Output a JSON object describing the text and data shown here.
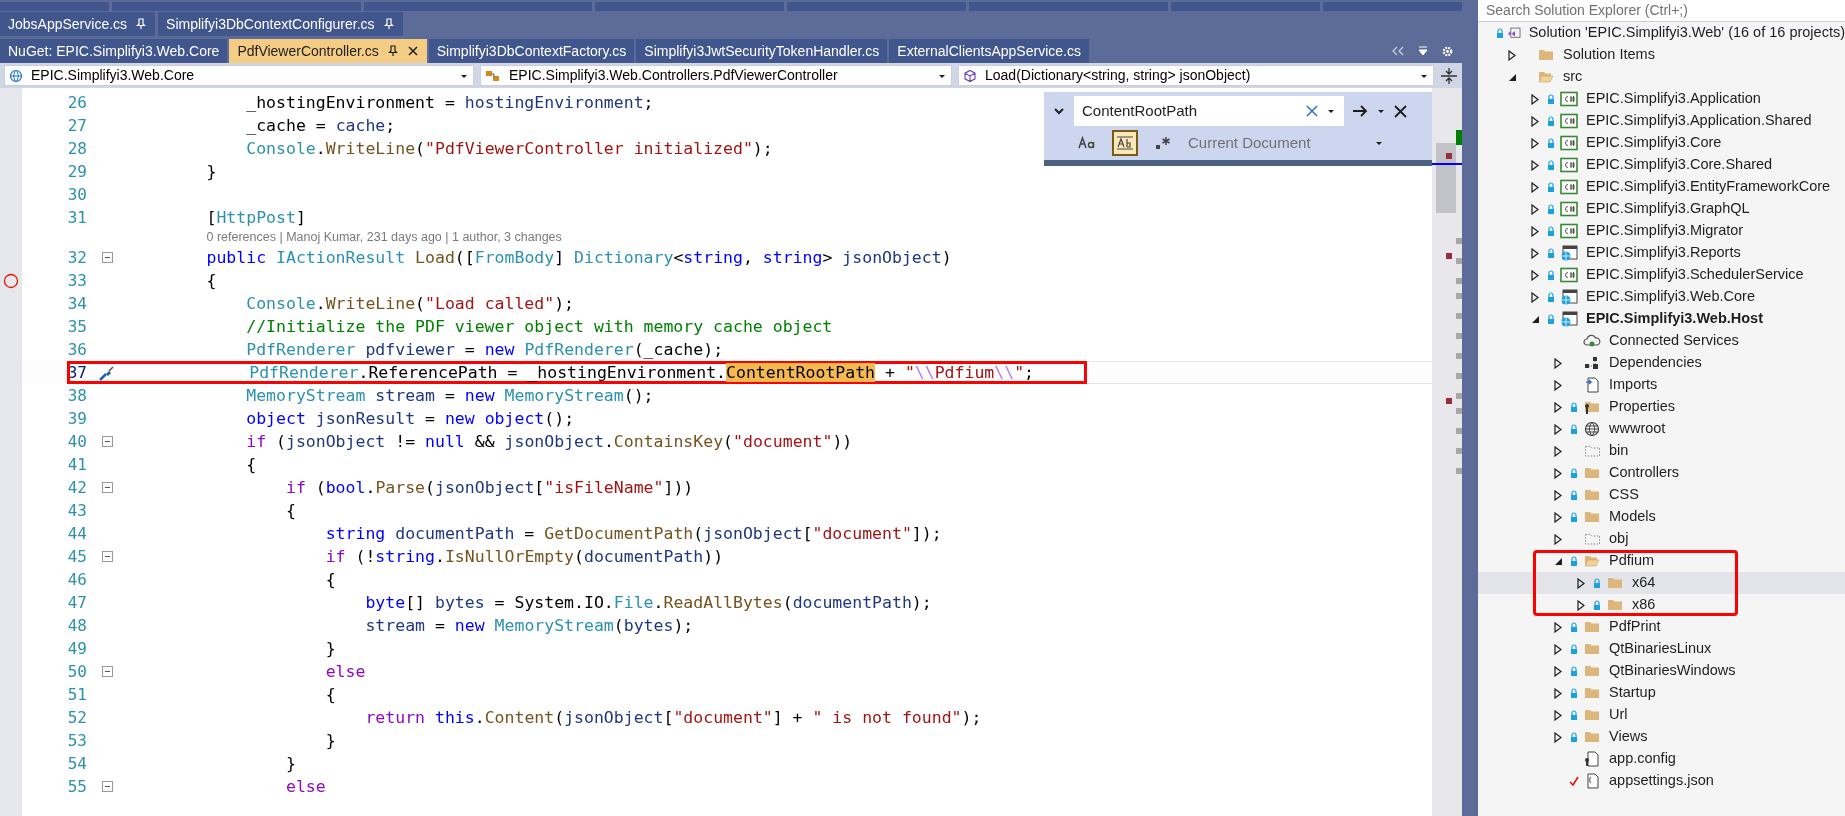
{
  "tabs_row_1": [
    {
      "label": "JobsAppService.cs",
      "pinned": true,
      "selected": false
    },
    {
      "label": "Simplifyi3DbContextConfigurer.cs",
      "pinned": true,
      "selected": false
    }
  ],
  "tabs_row_2": [
    {
      "label": "NuGet: EPIC.Simplifyi3.Web.Core",
      "pinned": false,
      "selected": false
    },
    {
      "label": "PdfViewerController.cs",
      "pinned": true,
      "selected": true
    },
    {
      "label": "Simplifyi3DbContextFactory.cs",
      "pinned": false,
      "selected": false
    },
    {
      "label": "Simplifyi3JwtSecurityTokenHandler.cs",
      "pinned": false,
      "selected": false
    },
    {
      "label": "ExternalClientsAppService.cs",
      "pinned": false,
      "selected": false
    }
  ],
  "nav_bar": [
    {
      "kind": "project",
      "label": "EPIC.Simplifyi3.Web.Core"
    },
    {
      "kind": "class",
      "label": "EPIC.Simplifyi3.Web.Controllers.PdfViewerController"
    },
    {
      "kind": "method",
      "label": "Load(Dictionary<string, string> jsonObject)"
    }
  ],
  "find_widget": {
    "value": "ContentRootPath",
    "match_case": false,
    "whole_word": true,
    "regex": false,
    "scope": "Current Document"
  },
  "code_lines": [
    {
      "kind": "code",
      "number": "26",
      "current": false,
      "annotated": false,
      "tokens": [
        {
          "kind": "plain",
          "text": "            _hostingEnvironment = "
        },
        {
          "kind": "local",
          "text": "hostingEnvironment"
        },
        {
          "kind": "plain",
          "text": ";"
        }
      ]
    },
    {
      "kind": "code",
      "number": "27",
      "current": false,
      "annotated": false,
      "tokens": [
        {
          "kind": "plain",
          "text": "            _cache = "
        },
        {
          "kind": "local",
          "text": "cache"
        },
        {
          "kind": "plain",
          "text": ";"
        }
      ]
    },
    {
      "kind": "code",
      "number": "28",
      "current": false,
      "annotated": false,
      "tokens": [
        {
          "kind": "type",
          "text": "            Console"
        },
        {
          "kind": "plain",
          "text": "."
        },
        {
          "kind": "method",
          "text": "WriteLine"
        },
        {
          "kind": "plain",
          "text": "("
        },
        {
          "kind": "str",
          "text": "\"PdfViewerController initialized\""
        },
        {
          "kind": "plain",
          "text": ");"
        }
      ]
    },
    {
      "kind": "code",
      "number": "29",
      "current": false,
      "annotated": false,
      "tokens": [
        {
          "kind": "plain",
          "text": "        }"
        }
      ]
    },
    {
      "kind": "code",
      "number": "30",
      "current": false,
      "annotated": false
    },
    {
      "kind": "code",
      "number": "31",
      "current": false,
      "annotated": false,
      "tokens": [
        {
          "kind": "plain",
          "text": "        ["
        },
        {
          "kind": "type",
          "text": "HttpPost"
        },
        {
          "kind": "plain",
          "text": "]"
        }
      ]
    },
    {
      "kind": "lens",
      "text": "0 references | Manoj Kumar, 231 days ago | 1 author, 3 changes"
    },
    {
      "kind": "code",
      "number": "32",
      "fold": true,
      "current": false,
      "annotated": false,
      "tokens": [
        {
          "kind": "kw",
          "text": "        public "
        },
        {
          "kind": "type",
          "text": "IActionResult "
        },
        {
          "kind": "method",
          "text": "Load"
        },
        {
          "kind": "plain",
          "text": "(["
        },
        {
          "kind": "type",
          "text": "FromBody"
        },
        {
          "kind": "plain",
          "text": "] "
        },
        {
          "kind": "type",
          "text": "Dictionary"
        },
        {
          "kind": "plain",
          "text": "<"
        },
        {
          "kind": "kw",
          "text": "string"
        },
        {
          "kind": "plain",
          "text": ", "
        },
        {
          "kind": "kw",
          "text": "string"
        },
        {
          "kind": "plain",
          "text": "> "
        },
        {
          "kind": "local",
          "text": "jsonObject"
        },
        {
          "kind": "plain",
          "text": ")"
        }
      ]
    },
    {
      "kind": "code",
      "number": "33",
      "breakpoint": true,
      "current": false,
      "annotated": false,
      "tokens": [
        {
          "kind": "plain",
          "text": "        {"
        }
      ]
    },
    {
      "kind": "code",
      "number": "34",
      "current": false,
      "annotated": false,
      "tokens": [
        {
          "kind": "type",
          "text": "            Console"
        },
        {
          "kind": "plain",
          "text": "."
        },
        {
          "kind": "method",
          "text": "WriteLine"
        },
        {
          "kind": "plain",
          "text": "("
        },
        {
          "kind": "str",
          "text": "\"Load called\""
        },
        {
          "kind": "plain",
          "text": ");"
        }
      ]
    },
    {
      "kind": "code",
      "number": "35",
      "current": false,
      "annotated": false,
      "tokens": [
        {
          "kind": "cmt",
          "text": "            //Initialize the PDF viewer object with memory cache object"
        }
      ]
    },
    {
      "kind": "code",
      "number": "36",
      "current": false,
      "annotated": false,
      "tokens": [
        {
          "kind": "type",
          "text": "            PdfRenderer "
        },
        {
          "kind": "local",
          "text": "pdfviewer"
        },
        {
          "kind": "plain",
          "text": " = "
        },
        {
          "kind": "kw",
          "text": "new "
        },
        {
          "kind": "type",
          "text": "PdfRenderer"
        },
        {
          "kind": "plain",
          "text": "(_cache);"
        }
      ]
    },
    {
      "kind": "code",
      "number": "37",
      "quick_action": true,
      "current": true,
      "annotated": true,
      "tokens": [
        {
          "kind": "type",
          "text": "            PdfRenderer"
        },
        {
          "kind": "plain",
          "text": ".ReferencePath = _hostingEnvironment."
        },
        {
          "kind": "match",
          "text": "ContentRootPath"
        },
        {
          "kind": "plain",
          "text": " + "
        },
        {
          "kind": "str",
          "text": "\""
        },
        {
          "kind": "esc",
          "text": "\\\\"
        },
        {
          "kind": "str",
          "text": "Pdfium"
        },
        {
          "kind": "esc",
          "text": "\\\\"
        },
        {
          "kind": "str",
          "text": "\""
        },
        {
          "kind": "plain",
          "text": ";"
        }
      ]
    },
    {
      "kind": "code",
      "number": "38",
      "current": false,
      "annotated": false,
      "tokens": [
        {
          "kind": "type",
          "text": "            MemoryStream "
        },
        {
          "kind": "local",
          "text": "stream"
        },
        {
          "kind": "plain",
          "text": " = "
        },
        {
          "kind": "kw",
          "text": "new "
        },
        {
          "kind": "type",
          "text": "MemoryStream"
        },
        {
          "kind": "plain",
          "text": "();"
        }
      ]
    },
    {
      "kind": "code",
      "number": "39",
      "current": false,
      "annotated": false,
      "tokens": [
        {
          "kind": "kw",
          "text": "            object "
        },
        {
          "kind": "local",
          "text": "jsonResult"
        },
        {
          "kind": "plain",
          "text": " = "
        },
        {
          "kind": "kw",
          "text": "new "
        },
        {
          "kind": "kw",
          "text": "object"
        },
        {
          "kind": "plain",
          "text": "();"
        }
      ]
    },
    {
      "kind": "code",
      "number": "40",
      "fold": true,
      "current": false,
      "annotated": false,
      "tokens": [
        {
          "kind": "ctl",
          "text": "            if "
        },
        {
          "kind": "plain",
          "text": "("
        },
        {
          "kind": "local",
          "text": "jsonObject"
        },
        {
          "kind": "plain",
          "text": " != "
        },
        {
          "kind": "kw",
          "text": "null"
        },
        {
          "kind": "plain",
          "text": " && "
        },
        {
          "kind": "local",
          "text": "jsonObject"
        },
        {
          "kind": "plain",
          "text": "."
        },
        {
          "kind": "method",
          "text": "ContainsKey"
        },
        {
          "kind": "plain",
          "text": "("
        },
        {
          "kind": "str",
          "text": "\"document\""
        },
        {
          "kind": "plain",
          "text": "))"
        }
      ]
    },
    {
      "kind": "code",
      "number": "41",
      "current": false,
      "annotated": false,
      "tokens": [
        {
          "kind": "plain",
          "text": "            {"
        }
      ]
    },
    {
      "kind": "code",
      "number": "42",
      "fold": true,
      "current": false,
      "annotated": false,
      "tokens": [
        {
          "kind": "ctl",
          "text": "                if "
        },
        {
          "kind": "plain",
          "text": "("
        },
        {
          "kind": "kw",
          "text": "bool"
        },
        {
          "kind": "plain",
          "text": "."
        },
        {
          "kind": "method",
          "text": "Parse"
        },
        {
          "kind": "plain",
          "text": "("
        },
        {
          "kind": "local",
          "text": "jsonObject"
        },
        {
          "kind": "plain",
          "text": "["
        },
        {
          "kind": "str",
          "text": "\"isFileName\""
        },
        {
          "kind": "plain",
          "text": "]))"
        }
      ]
    },
    {
      "kind": "code",
      "number": "43",
      "current": false,
      "annotated": false,
      "tokens": [
        {
          "kind": "plain",
          "text": "                {"
        }
      ]
    },
    {
      "kind": "code",
      "number": "44",
      "current": false,
      "annotated": false,
      "tokens": [
        {
          "kind": "kw",
          "text": "                    string "
        },
        {
          "kind": "local",
          "text": "documentPath"
        },
        {
          "kind": "plain",
          "text": " = "
        },
        {
          "kind": "method",
          "text": "GetDocumentPath"
        },
        {
          "kind": "plain",
          "text": "("
        },
        {
          "kind": "local",
          "text": "jsonObject"
        },
        {
          "kind": "plain",
          "text": "["
        },
        {
          "kind": "str",
          "text": "\"document\""
        },
        {
          "kind": "plain",
          "text": "]);"
        }
      ]
    },
    {
      "kind": "code",
      "number": "45",
      "fold": true,
      "current": false,
      "annotated": false,
      "tokens": [
        {
          "kind": "ctl",
          "text": "                    if "
        },
        {
          "kind": "plain",
          "text": "(!"
        },
        {
          "kind": "kw",
          "text": "string"
        },
        {
          "kind": "plain",
          "text": "."
        },
        {
          "kind": "method",
          "text": "IsNullOrEmpty"
        },
        {
          "kind": "plain",
          "text": "("
        },
        {
          "kind": "local",
          "text": "documentPath"
        },
        {
          "kind": "plain",
          "text": "))"
        }
      ]
    },
    {
      "kind": "code",
      "number": "46",
      "current": false,
      "annotated": false,
      "tokens": [
        {
          "kind": "plain",
          "text": "                    {"
        }
      ]
    },
    {
      "kind": "code",
      "number": "47",
      "current": false,
      "annotated": false,
      "tokens": [
        {
          "kind": "kw",
          "text": "                        byte"
        },
        {
          "kind": "plain",
          "text": "[] "
        },
        {
          "kind": "local",
          "text": "bytes"
        },
        {
          "kind": "plain",
          "text": " = System.IO."
        },
        {
          "kind": "type",
          "text": "File"
        },
        {
          "kind": "plain",
          "text": "."
        },
        {
          "kind": "method",
          "text": "ReadAllBytes"
        },
        {
          "kind": "plain",
          "text": "("
        },
        {
          "kind": "local",
          "text": "documentPath"
        },
        {
          "kind": "plain",
          "text": ");"
        }
      ]
    },
    {
      "kind": "code",
      "number": "48",
      "current": false,
      "annotated": false,
      "tokens": [
        {
          "kind": "local",
          "text": "                        stream"
        },
        {
          "kind": "plain",
          "text": " = "
        },
        {
          "kind": "kw",
          "text": "new "
        },
        {
          "kind": "type",
          "text": "MemoryStream"
        },
        {
          "kind": "plain",
          "text": "("
        },
        {
          "kind": "local",
          "text": "bytes"
        },
        {
          "kind": "plain",
          "text": ");"
        }
      ]
    },
    {
      "kind": "code",
      "number": "49",
      "current": false,
      "annotated": false,
      "tokens": [
        {
          "kind": "plain",
          "text": "                    }"
        }
      ]
    },
    {
      "kind": "code",
      "number": "50",
      "fold": true,
      "current": false,
      "annotated": false,
      "tokens": [
        {
          "kind": "ctl",
          "text": "                    else"
        }
      ]
    },
    {
      "kind": "code",
      "number": "51",
      "current": false,
      "annotated": false,
      "tokens": [
        {
          "kind": "plain",
          "text": "                    {"
        }
      ]
    },
    {
      "kind": "code",
      "number": "52",
      "current": false,
      "annotated": false,
      "tokens": [
        {
          "kind": "ctl",
          "text": "                        return "
        },
        {
          "kind": "kw",
          "text": "this"
        },
        {
          "kind": "plain",
          "text": "."
        },
        {
          "kind": "method",
          "text": "Content"
        },
        {
          "kind": "plain",
          "text": "("
        },
        {
          "kind": "local",
          "text": "jsonObject"
        },
        {
          "kind": "plain",
          "text": "["
        },
        {
          "kind": "str",
          "text": "\"document\""
        },
        {
          "kind": "plain",
          "text": "] + "
        },
        {
          "kind": "str",
          "text": "\" is not found\""
        },
        {
          "kind": "plain",
          "text": ");"
        }
      ]
    },
    {
      "kind": "code",
      "number": "53",
      "current": false,
      "annotated": false,
      "tokens": [
        {
          "kind": "plain",
          "text": "                    }"
        }
      ]
    },
    {
      "kind": "code",
      "number": "54",
      "current": false,
      "annotated": false,
      "tokens": [
        {
          "kind": "plain",
          "text": "                }"
        }
      ]
    },
    {
      "kind": "code",
      "number": "55",
      "fold": true,
      "current": false,
      "annotated": false,
      "tokens": [
        {
          "kind": "ctl",
          "text": "                else"
        }
      ]
    }
  ],
  "solution_explorer": {
    "search_placeholder": "Search Solution Explorer (Ctrl+;)",
    "tree": [
      {
        "label": "Solution 'EPIC.Simplifyi3.Web' (16 of 16 projects)",
        "kind": "solution",
        "locked": true,
        "selected": false,
        "annotated": false,
        "children": [
          {
            "label": "Solution Items",
            "kind": "folder",
            "locked": false,
            "selected": false,
            "annotated": false,
            "expanded": false
          },
          {
            "label": "src",
            "kind": "folder-open",
            "locked": false,
            "selected": false,
            "annotated": false,
            "expanded": true,
            "children": [
              {
                "label": "EPIC.Simplifyi3.Application",
                "kind": "csproj",
                "locked": true,
                "startup": false,
                "selected": false,
                "annotated": false,
                "expanded": false
              },
              {
                "label": "EPIC.Simplifyi3.Application.Shared",
                "kind": "csproj",
                "locked": true,
                "startup": false,
                "selected": false,
                "annotated": false,
                "expanded": false
              },
              {
                "label": "EPIC.Simplifyi3.Core",
                "kind": "csproj",
                "locked": true,
                "startup": false,
                "selected": false,
                "annotated": false,
                "expanded": false
              },
              {
                "label": "EPIC.Simplifyi3.Core.Shared",
                "kind": "csproj",
                "locked": true,
                "startup": false,
                "selected": false,
                "annotated": false,
                "expanded": false
              },
              {
                "label": "EPIC.Simplifyi3.EntityFrameworkCore",
                "kind": "csproj",
                "locked": true,
                "startup": false,
                "selected": false,
                "annotated": false,
                "expanded": false
              },
              {
                "label": "EPIC.Simplifyi3.GraphQL",
                "kind": "csproj",
                "locked": true,
                "startup": false,
                "selected": false,
                "annotated": false,
                "expanded": false
              },
              {
                "label": "EPIC.Simplifyi3.Migrator",
                "kind": "csproj",
                "locked": true,
                "startup": false,
                "selected": false,
                "annotated": false,
                "expanded": false
              },
              {
                "label": "EPIC.Simplifyi3.Reports",
                "kind": "webproj",
                "locked": true,
                "startup": false,
                "selected": false,
                "annotated": false,
                "expanded": false
              },
              {
                "label": "EPIC.Simplifyi3.SchedulerService",
                "kind": "csproj",
                "locked": true,
                "startup": false,
                "selected": false,
                "annotated": false,
                "expanded": false
              },
              {
                "label": "EPIC.Simplifyi3.Web.Core",
                "kind": "webproj",
                "locked": true,
                "startup": false,
                "selected": false,
                "annotated": false,
                "expanded": false
              },
              {
                "label": "EPIC.Simplifyi3.Web.Host",
                "kind": "webproj",
                "locked": true,
                "startup": true,
                "selected": false,
                "annotated": false,
                "expanded": true,
                "children": [
                  {
                    "label": "Connected Services",
                    "kind": "cloud",
                    "locked": false,
                    "checked_out": false,
                    "selected": false,
                    "annotated": false
                  },
                  {
                    "label": "Dependencies",
                    "kind": "dependencies",
                    "locked": false,
                    "checked_out": false,
                    "selected": false,
                    "annotated": false,
                    "expanded": false
                  },
                  {
                    "label": "Imports",
                    "kind": "imports",
                    "locked": false,
                    "checked_out": false,
                    "selected": false,
                    "annotated": false,
                    "expanded": false
                  },
                  {
                    "label": "Properties",
                    "kind": "properties",
                    "locked": true,
                    "checked_out": false,
                    "selected": false,
                    "annotated": false,
                    "expanded": false
                  },
                  {
                    "label": "wwwroot",
                    "kind": "globe",
                    "locked": true,
                    "checked_out": false,
                    "selected": false,
                    "annotated": false,
                    "expanded": false
                  },
                  {
                    "label": "bin",
                    "kind": "dotted-folder",
                    "locked": false,
                    "checked_out": false,
                    "selected": false,
                    "annotated": false,
                    "expanded": false
                  },
                  {
                    "label": "Controllers",
                    "kind": "folder",
                    "locked": true,
                    "checked_out": false,
                    "selected": false,
                    "annotated": false,
                    "expanded": false
                  },
                  {
                    "label": "CSS",
                    "kind": "folder",
                    "locked": true,
                    "checked_out": false,
                    "selected": false,
                    "annotated": false,
                    "expanded": false
                  },
                  {
                    "label": "Models",
                    "kind": "folder",
                    "locked": true,
                    "checked_out": false,
                    "selected": false,
                    "annotated": false,
                    "expanded": false
                  },
                  {
                    "label": "obj",
                    "kind": "dotted-folder",
                    "locked": false,
                    "checked_out": false,
                    "selected": false,
                    "annotated": false,
                    "expanded": false
                  },
                  {
                    "label": "Pdfium",
                    "kind": "folder-open",
                    "locked": true,
                    "checked_out": false,
                    "selected": false,
                    "annotated": true,
                    "expanded": true,
                    "children": [
                      {
                        "label": "x64",
                        "kind": "folder",
                        "locked": true,
                        "selected": true,
                        "annotated": false,
                        "expanded": false
                      },
                      {
                        "label": "x86",
                        "kind": "folder",
                        "locked": true,
                        "selected": false,
                        "annotated": false,
                        "expanded": false
                      }
                    ]
                  },
                  {
                    "label": "PdfPrint",
                    "kind": "folder",
                    "locked": true,
                    "checked_out": false,
                    "selected": false,
                    "annotated": false,
                    "expanded": false
                  },
                  {
                    "label": "QtBinariesLinux",
                    "kind": "folder",
                    "locked": true,
                    "checked_out": false,
                    "selected": false,
                    "annotated": false,
                    "expanded": false
                  },
                  {
                    "label": "QtBinariesWindows",
                    "kind": "folder",
                    "locked": true,
                    "checked_out": false,
                    "selected": false,
                    "annotated": false,
                    "expanded": false
                  },
                  {
                    "label": "Startup",
                    "kind": "folder",
                    "locked": true,
                    "checked_out": false,
                    "selected": false,
                    "annotated": false,
                    "expanded": false
                  },
                  {
                    "label": "Url",
                    "kind": "folder",
                    "locked": true,
                    "checked_out": false,
                    "selected": false,
                    "annotated": false,
                    "expanded": false
                  },
                  {
                    "label": "Views",
                    "kind": "folder",
                    "locked": true,
                    "checked_out": false,
                    "selected": false,
                    "annotated": false,
                    "expanded": false
                  },
                  {
                    "label": "app.config",
                    "kind": "config",
                    "locked": false,
                    "checked_out": false,
                    "selected": false,
                    "annotated": false
                  },
                  {
                    "label": "appsettings.json",
                    "kind": "json",
                    "locked": false,
                    "checked_out": true,
                    "selected": false,
                    "annotated": false
                  }
                ]
              }
            ]
          }
        ]
      }
    ]
  }
}
